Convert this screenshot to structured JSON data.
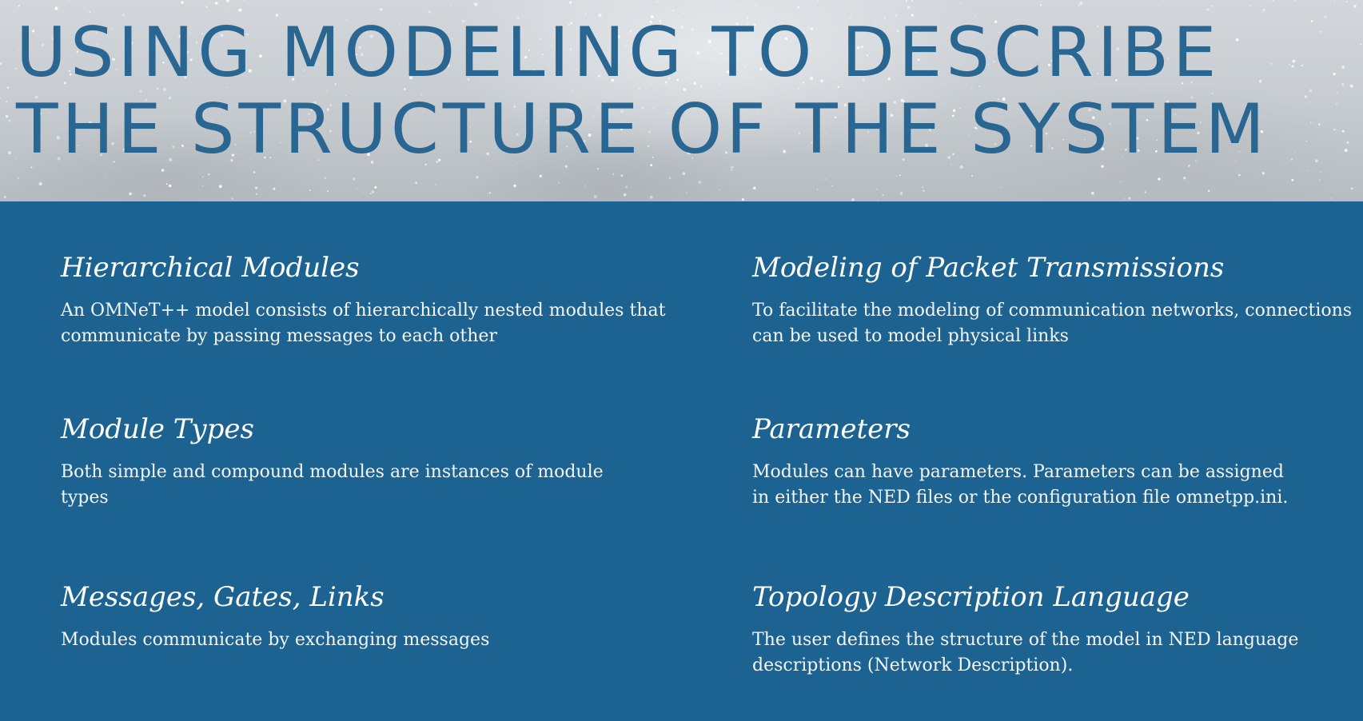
{
  "slide": {
    "title_line1": "USING MODELING TO DESCRIBE",
    "title_line2": "THE STRUCTURE OF THE SYSTEM"
  },
  "sections": [
    {
      "heading": "Hierarchical Modules",
      "body": "An OMNeT++ model consists of hierarchically nested modules that communicate by passing messages to each other"
    },
    {
      "heading": "Modeling of Packet Transmissions",
      "body": "To facilitate the modeling of communication networks, connections can be used to model physical links"
    },
    {
      "heading": "Module Types",
      "body": "Both simple and compound modules are instances of module types"
    },
    {
      "heading": "Parameters",
      "body": "Modules can have parameters. Parameters can be assigned in either the NED files or the configuration file omnetpp.ini."
    },
    {
      "heading": "Messages, Gates, Links",
      "body": "Modules communicate by exchanging messages"
    },
    {
      "heading": "Topology Description Language",
      "body": "The user defines the structure of the model in NED language descriptions (Network Description)."
    }
  ],
  "colors": {
    "title_text": "#2a6692",
    "panel_background": "#1d6391",
    "body_text": "#ffffff"
  }
}
